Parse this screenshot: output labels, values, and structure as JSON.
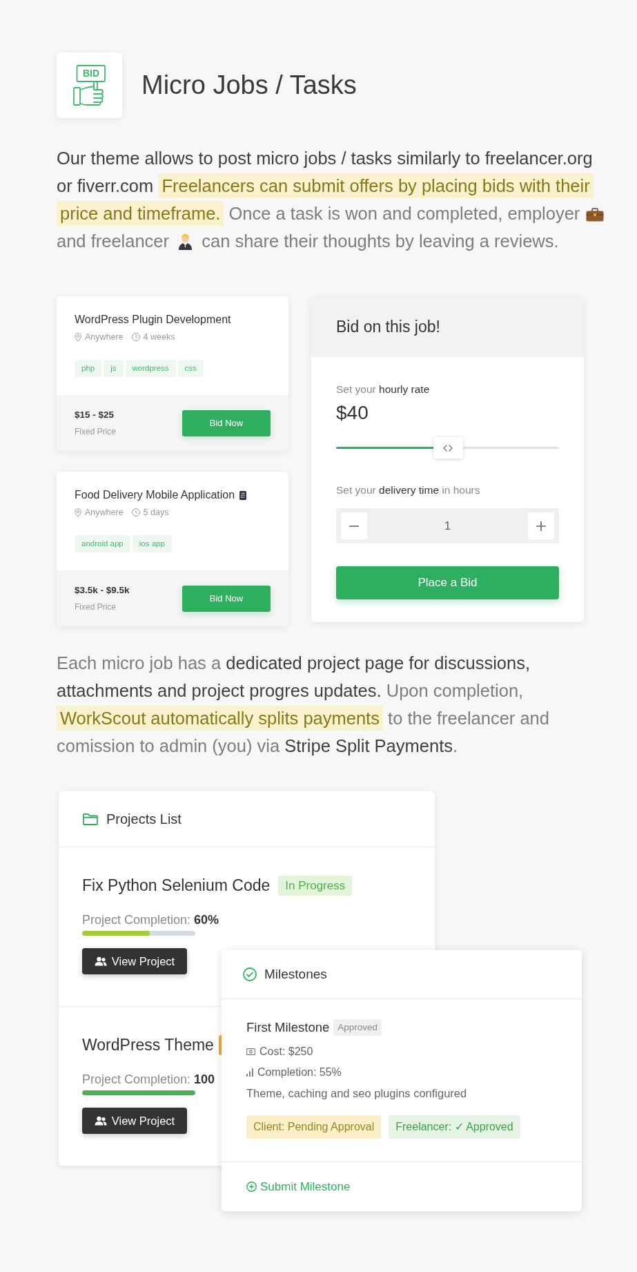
{
  "header": {
    "title": "Micro Jobs / Tasks",
    "icon_label": "BID"
  },
  "intro": {
    "segments": [
      {
        "text": "Our theme allows to post micro jobs / tasks similarly to freelancer.org or fiverr.com ",
        "kind": "strong"
      },
      {
        "text": "Freelancers can submit offers by placing bids with their price and timeframe.",
        "kind": "highlight"
      },
      {
        "text": " Once a task is won and completed, employer ",
        "kind": "muted",
        "icon_after": true
      },
      {
        "text": " and  freelancer ",
        "kind": "muted",
        "icon_after": true
      },
      {
        "text": " can share their thoughts by leaving a reviews.",
        "kind": "muted"
      }
    ]
  },
  "job_cards": [
    {
      "title": "WordPress Plugin Development",
      "location": "Anywhere",
      "duration": "4 weeks",
      "tags": [
        "php",
        "js",
        "wordpress",
        "css"
      ],
      "price": "$15 - $25",
      "price_type": "Fixed Price",
      "button": "Bid Now"
    },
    {
      "title": "Food Delivery Mobile Application",
      "title_icon": true,
      "location": "Anywhere",
      "duration": "5 days",
      "tags": [
        "android app",
        "ios app"
      ],
      "price": "$3.5k - $9.5k",
      "price_type": "Fixed Price",
      "button": "Bid Now"
    }
  ],
  "bid_panel": {
    "title": "Bid on this job!",
    "rate_label": [
      {
        "text": "Set your ",
        "kind": "muted"
      },
      {
        "text": "hourly rate",
        "kind": "strong"
      }
    ],
    "rate_value": "$40",
    "rate_slider": {
      "level": 0.5
    },
    "hours_label": [
      {
        "text": "Set your ",
        "kind": "muted"
      },
      {
        "text": "delivery time",
        "kind": "strong"
      },
      {
        "text": " in hours",
        "kind": "muted"
      }
    ],
    "hours_value": "1",
    "button": "Place a Bid"
  },
  "details": {
    "segments": [
      {
        "text": "Each micro job has a ",
        "kind": "muted"
      },
      {
        "text": "dedicated project page for discussions, attachments and project progres updates.",
        "kind": "strong"
      },
      {
        "text": "  Upon completion, ",
        "kind": "muted"
      },
      {
        "text": "WorkScout automatically splits payments",
        "kind": "highlight"
      },
      {
        "text": " to the freelancer and comission to admin (you) via ",
        "kind": "muted"
      },
      {
        "text": "Stripe Split Payments",
        "kind": "strong"
      },
      {
        "text": ".",
        "kind": "muted"
      }
    ]
  },
  "projects_list": {
    "title": "Projects List",
    "items": [
      {
        "title": "Fix Python Selenium Code",
        "badge": {
          "text": "In Progress",
          "color": "#e1f5d8"
        },
        "completion_label": "Project Completion:",
        "completion_value": "60%",
        "level": 0.6,
        "button": "View Project"
      },
      {
        "title": "WordPress Theme",
        "badge": {
          "color": "#f2a541"
        },
        "completion_label": "Project Completion:",
        "completion_value": "100",
        "level": 1,
        "button": "View Project"
      }
    ]
  },
  "milestones": {
    "title": "Milestones",
    "items": [
      {
        "title": "First Milestone",
        "status": "Approved",
        "cost": "Cost: $250",
        "completion": "Completion: 55%",
        "description": "Theme, caching and seo plugins configured",
        "approvals": [
          {
            "text": "Client: Pending Approval",
            "kind": "pending"
          },
          {
            "text": "Freelancer: ✓ Approved",
            "kind": "approved"
          }
        ]
      }
    ],
    "action": "Submit Milestone"
  }
}
